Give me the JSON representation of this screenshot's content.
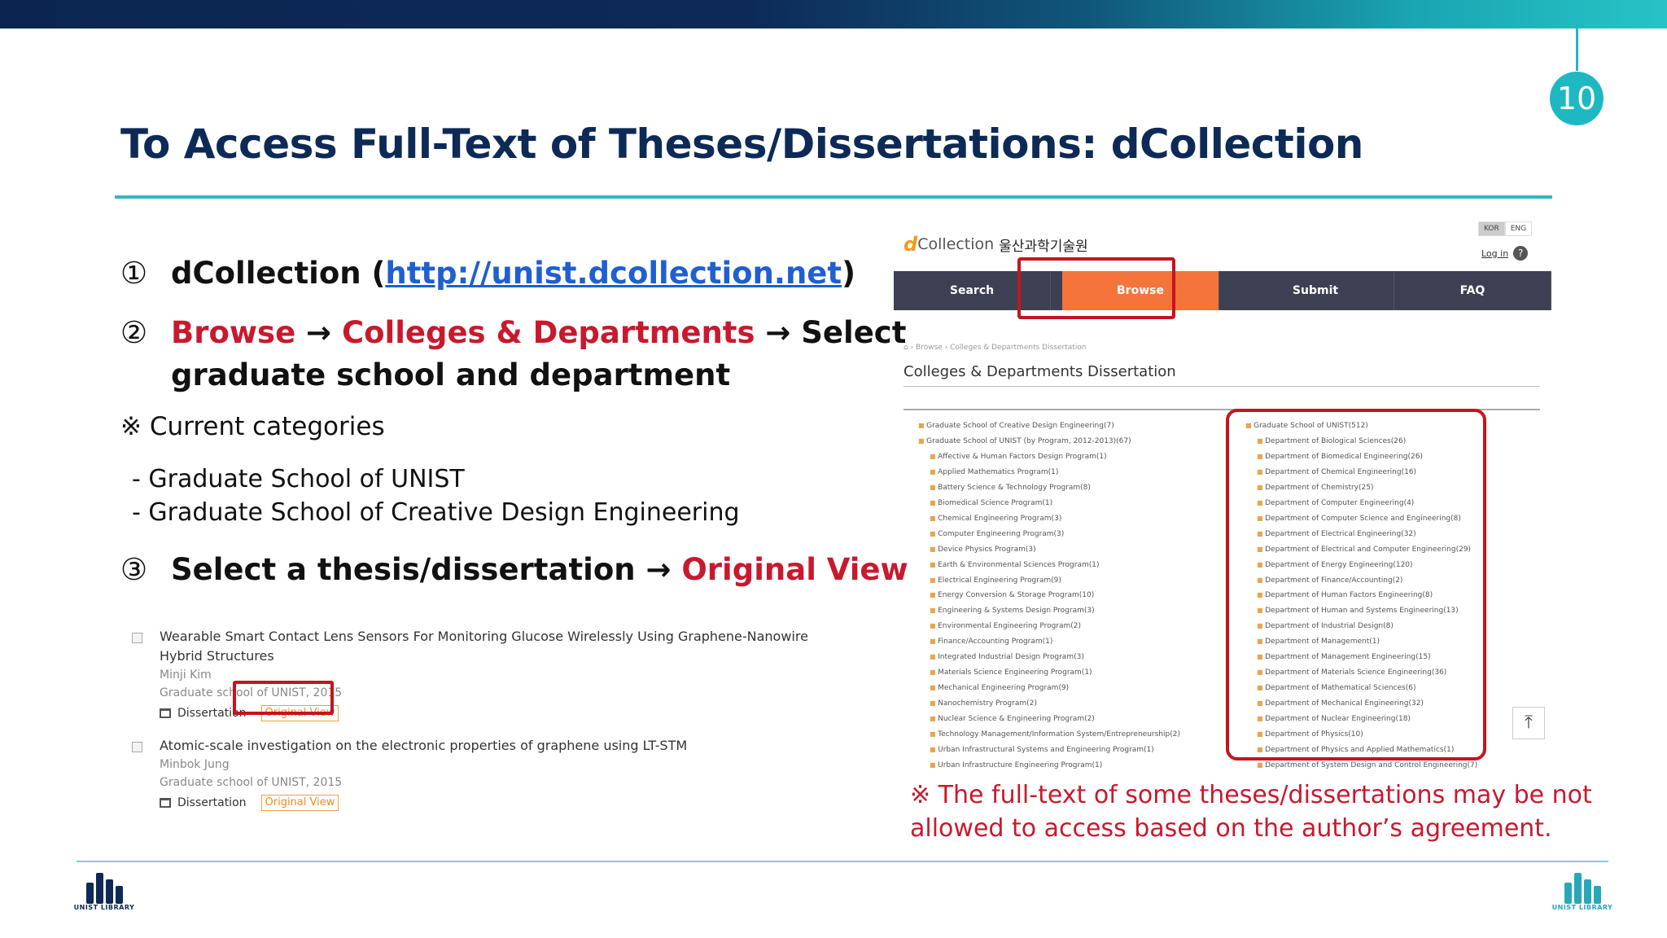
{
  "page_number": "10",
  "title": "To Access Full-Text of Theses/Dissertations: dCollection",
  "steps": {
    "s1": {
      "num": "①",
      "text_pre": "dCollection (",
      "link": "http://unist.dcollection.net",
      "text_post": ")"
    },
    "s2": {
      "num": "②",
      "browse": "Browse",
      "arrow1": " → ",
      "colleges": "Colleges & Departments",
      "arrow2": " → Select",
      "line2": "graduate school and department"
    },
    "s3": {
      "num": "③",
      "text": "Select a thesis/dissertation → ",
      "red": "Original View"
    }
  },
  "note": "※ Current categories",
  "categories": [
    "- Graduate School of UNIST",
    "- Graduate School of Creative Design Engineering"
  ],
  "results": [
    {
      "title": "Wearable Smart Contact Lens Sensors For Monitoring Glucose Wirelessly Using Graphene-Nanowire Hybrid Structures",
      "author": "Minji Kim",
      "school": "Graduate school of UNIST, 2015",
      "type": "Dissertation",
      "button": "Original View"
    },
    {
      "title": "Atomic-scale investigation on the electronic properties of graphene using LT-STM",
      "author": "Minbok Jung",
      "school": "Graduate school of UNIST, 2015",
      "type": "Dissertation",
      "button": "Original View"
    }
  ],
  "site": {
    "logo_d": "d",
    "logo_collection": "Collection",
    "logo_kor": "울산과학기술원",
    "lang_kor": "KOR",
    "lang_eng": "ENG",
    "login": "Log in",
    "help": "?",
    "nav": [
      "Search",
      "Browse",
      "Submit",
      "FAQ"
    ],
    "breadcrumb": "⌂  ›  Browse  ›  Colleges & Departments Dissertation",
    "section_title": "Colleges & Departments Dissertation",
    "top_button": "⤒"
  },
  "tree_left": [
    {
      "t": "Graduate School of Creative Design Engineering(7)",
      "sub": false
    },
    {
      "t": "Graduate School of UNIST (by Program, 2012-2013)(67)",
      "sub": false
    },
    {
      "t": "Affective & Human Factors Design Program(1)",
      "sub": true
    },
    {
      "t": "Applied Mathematics Program(1)",
      "sub": true
    },
    {
      "t": "Battery Science & Technology Program(8)",
      "sub": true
    },
    {
      "t": "Biomedical Science Program(1)",
      "sub": true
    },
    {
      "t": "Chemical Engineering Program(3)",
      "sub": true
    },
    {
      "t": "Computer Engineering Program(3)",
      "sub": true
    },
    {
      "t": "Device Physics Program(3)",
      "sub": true
    },
    {
      "t": "Earth & Environmental Sciences Program(1)",
      "sub": true
    },
    {
      "t": "Electrical Engineering Program(9)",
      "sub": true
    },
    {
      "t": "Energy Conversion & Storage Program(10)",
      "sub": true
    },
    {
      "t": "Engineering & Systems Design Program(3)",
      "sub": true
    },
    {
      "t": "Environmental Engineering Program(2)",
      "sub": true
    },
    {
      "t": "Finance/Accounting Program(1)",
      "sub": true
    },
    {
      "t": "Integrated Industrial Design Program(3)",
      "sub": true
    },
    {
      "t": "Materials Science Engineering Program(1)",
      "sub": true
    },
    {
      "t": "Mechanical Engineering Program(9)",
      "sub": true
    },
    {
      "t": "Nanochemistry Program(2)",
      "sub": true
    },
    {
      "t": "Nuclear Science & Engineering Program(2)",
      "sub": true
    },
    {
      "t": "Technology Management/Information System/Entrepreneurship(2)",
      "sub": true
    },
    {
      "t": "Urban Infrastructural Systems and Engineering Program(1)",
      "sub": true
    },
    {
      "t": "Urban Infrastructure Engineering Program(1)",
      "sub": true
    }
  ],
  "tree_right": [
    {
      "t": "Graduate School of UNIST(512)",
      "sub": false
    },
    {
      "t": "Department of Biological Sciences(26)",
      "sub": true
    },
    {
      "t": "Department of Biomedical Engineering(26)",
      "sub": true
    },
    {
      "t": "Department of Chemical Engineering(16)",
      "sub": true
    },
    {
      "t": "Department of Chemistry(25)",
      "sub": true
    },
    {
      "t": "Department of Computer Engineering(4)",
      "sub": true
    },
    {
      "t": "Department of Computer Science and Engineering(8)",
      "sub": true
    },
    {
      "t": "Department of Electrical Engineering(32)",
      "sub": true
    },
    {
      "t": "Department of Electrical and Computer Engineering(29)",
      "sub": true
    },
    {
      "t": "Department of Energy Engineering(120)",
      "sub": true
    },
    {
      "t": "Department of Finance/Accounting(2)",
      "sub": true
    },
    {
      "t": "Department of Human Factors Engineering(8)",
      "sub": true
    },
    {
      "t": "Department of Human and Systems Engineering(13)",
      "sub": true
    },
    {
      "t": "Department of Industrial Design(8)",
      "sub": true
    },
    {
      "t": "Department of Management(1)",
      "sub": true
    },
    {
      "t": "Department of Management Engineering(15)",
      "sub": true
    },
    {
      "t": "Department of Materials Science Engineering(36)",
      "sub": true
    },
    {
      "t": "Department of Mathematical Sciences(6)",
      "sub": true
    },
    {
      "t": "Department of Mechanical Engineering(32)",
      "sub": true
    },
    {
      "t": "Department of Nuclear Engineering(18)",
      "sub": true
    },
    {
      "t": "Department of Physics(10)",
      "sub": true
    },
    {
      "t": "Department of Physics and Applied Mathematics(1)",
      "sub": true
    },
    {
      "t": "Department of System Design and Control Engineering(7)",
      "sub": true
    }
  ],
  "warning": [
    "※ The full-text of some theses/dissertations may be not",
    "allowed to access based on the author’s agreement."
  ],
  "footer_logo": "UNIST LIBRARY",
  "colors": {
    "navy": "#0d2a57",
    "teal": "#27b3c0",
    "red": "#c8192e",
    "orange": "#f4743b"
  }
}
